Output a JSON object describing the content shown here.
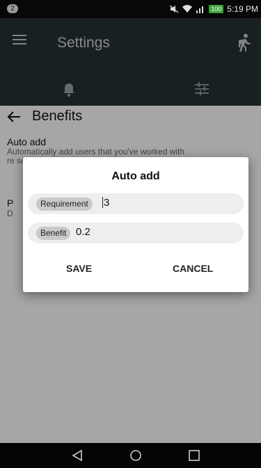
{
  "status_bar": {
    "notification_count": "2",
    "battery": "100",
    "time": "5:19 PM"
  },
  "toolbar": {
    "title": "Settings"
  },
  "page": {
    "title": "Benefits",
    "auto_add": {
      "title": "Auto add",
      "description_line1": "Automatically add users that you've worked with",
      "description_rest": "re se N"
    },
    "second_setting": {
      "title": "P",
      "description": "D"
    }
  },
  "dialog": {
    "title": "Auto add",
    "requirement": {
      "label": "Requirement",
      "value": "3"
    },
    "benefit": {
      "label": "Benefit",
      "value": "0.2"
    },
    "save_label": "SAVE",
    "cancel_label": "CANCEL"
  },
  "icons": {
    "menu": "menu-icon",
    "run": "run-icon",
    "bell": "bell-icon",
    "tune": "tune-icon",
    "back": "back-arrow-icon"
  }
}
